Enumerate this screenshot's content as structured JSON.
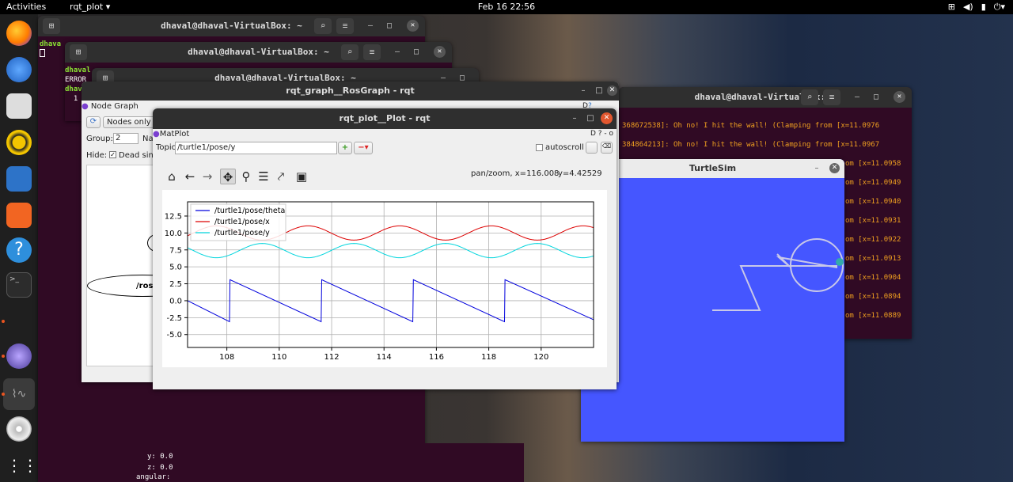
{
  "topbar": {
    "activities": "Activities",
    "app_menu": "rqt_plot ▾",
    "clock": "Feb 16  22:56"
  },
  "dock": {
    "items": [
      "firefox-icon",
      "thunderbird-icon",
      "files-icon",
      "rhythmbox-icon",
      "writer-icon",
      "software-icon",
      "help-icon",
      "terminal-icon",
      "rqt-icon",
      "plot-icon",
      "dvd-icon",
      "apps-grid-icon"
    ]
  },
  "term1": {
    "title": "dhaval@dhaval-VirtualBox: ~",
    "peek_text": "dhava",
    "bottom_lines": [
      "y: 0.0",
      "z: 0.0",
      "angular:"
    ]
  },
  "term2": {
    "title": "dhaval@dhaval-VirtualBox: ~",
    "lines": [
      "dhaval",
      "ERROR",
      "dhava",
      "  1"
    ]
  },
  "term3": {
    "title": "dhaval@dhaval-VirtualBox: ~"
  },
  "term4": {
    "title": "dhaval@dhaval-VirtualBox: ~",
    "lines": [
      "368672538]: Oh no! I hit the wall! (Clamping from [x=11.0976",
      "384864213]: Oh no! I hit the wall! (Clamping from [x=11.0967",
      "om [x=11.0958",
      "om [x=11.0949",
      "om [x=11.0940",
      "om [x=11.0931",
      "om [x=11.0922",
      "om [x=11.0913",
      "om [x=11.0904",
      "om [x=11.0894",
      "om [x=11.0889"
    ]
  },
  "rosgraph": {
    "title": "rqt_graph__RosGraph - rqt",
    "plugin_title": "Node Graph",
    "refresh_icon": "refresh-icon",
    "nodes_only": "Nodes only",
    "group_label": "Group:",
    "group_value": "2",
    "namespace_label": "Na",
    "hide_label": "Hide:",
    "dead_sinks": "Dead sink",
    "node_label": "/rost"
  },
  "plotwin": {
    "title": "rqt_plot__Plot - rqt",
    "plugin_title": "MatPlot",
    "plugin_buttons": "D ? -  o",
    "topic_label": "Topic",
    "topic_value": "/turtle1/pose/y",
    "autoscroll": "autoscroll",
    "status_mode": "pan/zoom, x=116.008",
    "status_y": "y=4.42529",
    "toolbar": [
      "home-icon",
      "back-icon",
      "forward-icon",
      "pan-icon",
      "zoom-icon",
      "configure-icon",
      "axes-icon",
      "save-icon"
    ]
  },
  "turtlesim": {
    "title": "TurtleSim",
    "background": "#4556ff"
  },
  "chart_data": {
    "type": "line",
    "xlim": [
      106.5,
      122
    ],
    "ylim": [
      -6.9,
      14.6
    ],
    "x_ticks": [
      108,
      110,
      112,
      114,
      116,
      118,
      120
    ],
    "y_ticks": [
      -5.0,
      -2.5,
      0.0,
      2.5,
      5.0,
      7.5,
      10.0,
      12.5
    ],
    "x_tick_labels": [
      "108",
      "110",
      "112",
      "114",
      "116",
      "118",
      "120"
    ],
    "y_tick_labels": [
      "-5.0",
      "-2.5",
      "0.0",
      "2.5",
      "5.0",
      "7.5",
      "10.0",
      "12.5"
    ],
    "grid": true,
    "legend_position": "top-left",
    "series": [
      {
        "name": "/turtle1/pose/theta",
        "color": "#0000dd",
        "x": [
          106.5,
          108.1,
          108.12,
          111.6,
          111.62,
          115.1,
          115.12,
          118.6,
          118.62,
          122
        ],
        "y": [
          0.0,
          -3.1,
          3.1,
          -3.1,
          3.1,
          -3.1,
          3.1,
          -3.1,
          3.1,
          -2.8
        ]
      },
      {
        "name": "/turtle1/pose/x",
        "color": "#dd0000",
        "wave": {
          "center": 10.0,
          "amplitude": 1.05,
          "period": 3.5,
          "phase_x": 107.6
        }
      },
      {
        "name": "/turtle1/pose/y",
        "color": "#00d5dd",
        "wave": {
          "center": 7.4,
          "amplitude": 1.05,
          "period": 3.5,
          "phase_x": 109.35
        }
      }
    ]
  }
}
